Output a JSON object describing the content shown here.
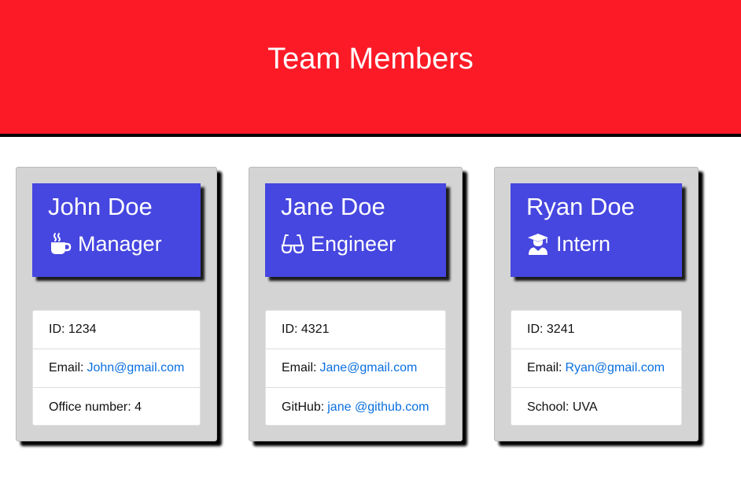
{
  "page": {
    "title": "Team Members",
    "header_color": "#fc1a27",
    "card_head_color": "#4646e0",
    "link_color": "#0a6fe0"
  },
  "members": [
    {
      "name": "John Doe",
      "role": "Manager",
      "role_icon": "coffee-cup-icon",
      "id_label": "ID:",
      "id": "1234",
      "email_label": "Email:",
      "email": "John@gmail.com",
      "extra_label": "Office number:",
      "extra_value": "4"
    },
    {
      "name": "Jane Doe",
      "role": "Engineer",
      "role_icon": "glasses-icon",
      "id_label": "ID:",
      "id": "4321",
      "email_label": "Email:",
      "email": "Jane@gmail.com",
      "extra_label": "GitHub:",
      "extra_value": "jane @github.com"
    },
    {
      "name": "Ryan Doe",
      "role": "Intern",
      "role_icon": "graduate-icon",
      "id_label": "ID:",
      "id": "3241",
      "email_label": "Email:",
      "email": "Ryan@gmail.com",
      "extra_label": "School:",
      "extra_value": "UVA"
    }
  ]
}
